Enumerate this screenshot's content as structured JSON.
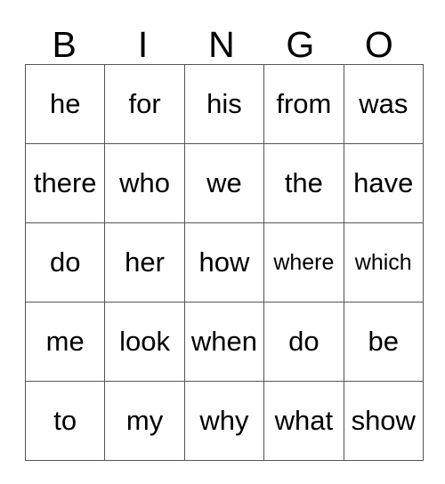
{
  "card": {
    "title": "BINGO",
    "headers": [
      "B",
      "I",
      "N",
      "G",
      "O"
    ],
    "colors": {
      "background": "#ffffff",
      "text": "#000000",
      "grid_line": "#555555",
      "grid_outer": "#808080"
    },
    "rows": [
      {
        "cells": [
          {
            "word": "he",
            "size": "normal"
          },
          {
            "word": "for",
            "size": "normal"
          },
          {
            "word": "his",
            "size": "normal"
          },
          {
            "word": "from",
            "size": "normal"
          },
          {
            "word": "was",
            "size": "normal"
          }
        ]
      },
      {
        "cells": [
          {
            "word": "there",
            "size": "normal"
          },
          {
            "word": "who",
            "size": "normal"
          },
          {
            "word": "we",
            "size": "normal"
          },
          {
            "word": "the",
            "size": "normal"
          },
          {
            "word": "have",
            "size": "normal"
          }
        ]
      },
      {
        "cells": [
          {
            "word": "do",
            "size": "normal"
          },
          {
            "word": "her",
            "size": "normal"
          },
          {
            "word": "how",
            "size": "normal"
          },
          {
            "word": "where",
            "size": "small"
          },
          {
            "word": "which",
            "size": "small"
          }
        ]
      },
      {
        "cells": [
          {
            "word": "me",
            "size": "normal"
          },
          {
            "word": "look",
            "size": "normal"
          },
          {
            "word": "when",
            "size": "normal"
          },
          {
            "word": "do",
            "size": "normal"
          },
          {
            "word": "be",
            "size": "normal"
          }
        ]
      },
      {
        "cells": [
          {
            "word": "to",
            "size": "normal"
          },
          {
            "word": "my",
            "size": "normal"
          },
          {
            "word": "why",
            "size": "normal"
          },
          {
            "word": "what",
            "size": "normal"
          },
          {
            "word": "show",
            "size": "normal"
          }
        ]
      }
    ]
  }
}
